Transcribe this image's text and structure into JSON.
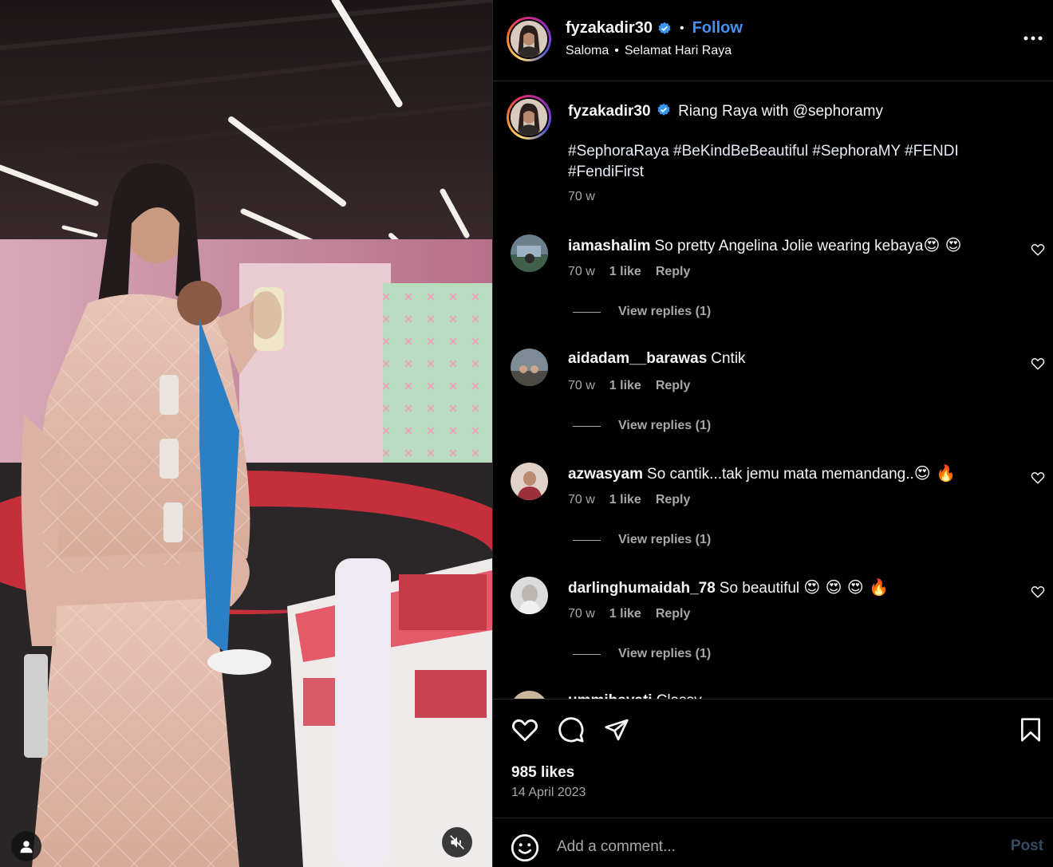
{
  "post": {
    "author": "fyzakadir30",
    "follow_label": "Follow",
    "audio": "Saloma",
    "audio_track": "Selamat Hari Raya",
    "more_label": "More options"
  },
  "caption": {
    "author": "fyzakadir30",
    "text": "Riang Raya with @sephoramy",
    "hashtags": "#SephoraRaya #BeKindBeBeautiful #SephoraMY #FENDI #FendiFirst",
    "time": "70 w"
  },
  "comments": [
    {
      "user": "iamashalim",
      "text": "So pretty Angelina Jolie wearing kebaya",
      "emoji": "😍 😍",
      "time": "70 w",
      "likes": "1 like",
      "reply_label": "Reply",
      "view_replies": "View replies (1)"
    },
    {
      "user": "aidadam__barawas",
      "text": "Cntik",
      "emoji": "",
      "time": "70 w",
      "likes": "1 like",
      "reply_label": "Reply",
      "view_replies": "View replies (1)"
    },
    {
      "user": "azwasyam",
      "text": "So cantik...tak jemu mata memandang..",
      "emoji": "😍 🔥",
      "time": "70 w",
      "likes": "1 like",
      "reply_label": "Reply",
      "view_replies": "View replies (1)"
    },
    {
      "user": "darlinghumaidah_78",
      "text": "So beautiful",
      "emoji": "😍 😍 😍 🔥",
      "time": "70 w",
      "likes": "1 like",
      "reply_label": "Reply",
      "view_replies": "View replies (1)"
    },
    {
      "user": "ummihayati",
      "text": "Classy",
      "emoji": "",
      "time": "",
      "likes": "",
      "reply_label": "",
      "view_replies": ""
    }
  ],
  "footer": {
    "likes": "985 likes",
    "date": "14 April 2023"
  },
  "composer": {
    "placeholder": "Add a comment...",
    "post_label": "Post"
  },
  "colors": {
    "background": "#000000",
    "link_blue": "#4a90f0",
    "muted_text": "#a8a8a8",
    "post_disabled": "#3a4a63",
    "verified_blue": "#3897f0"
  }
}
